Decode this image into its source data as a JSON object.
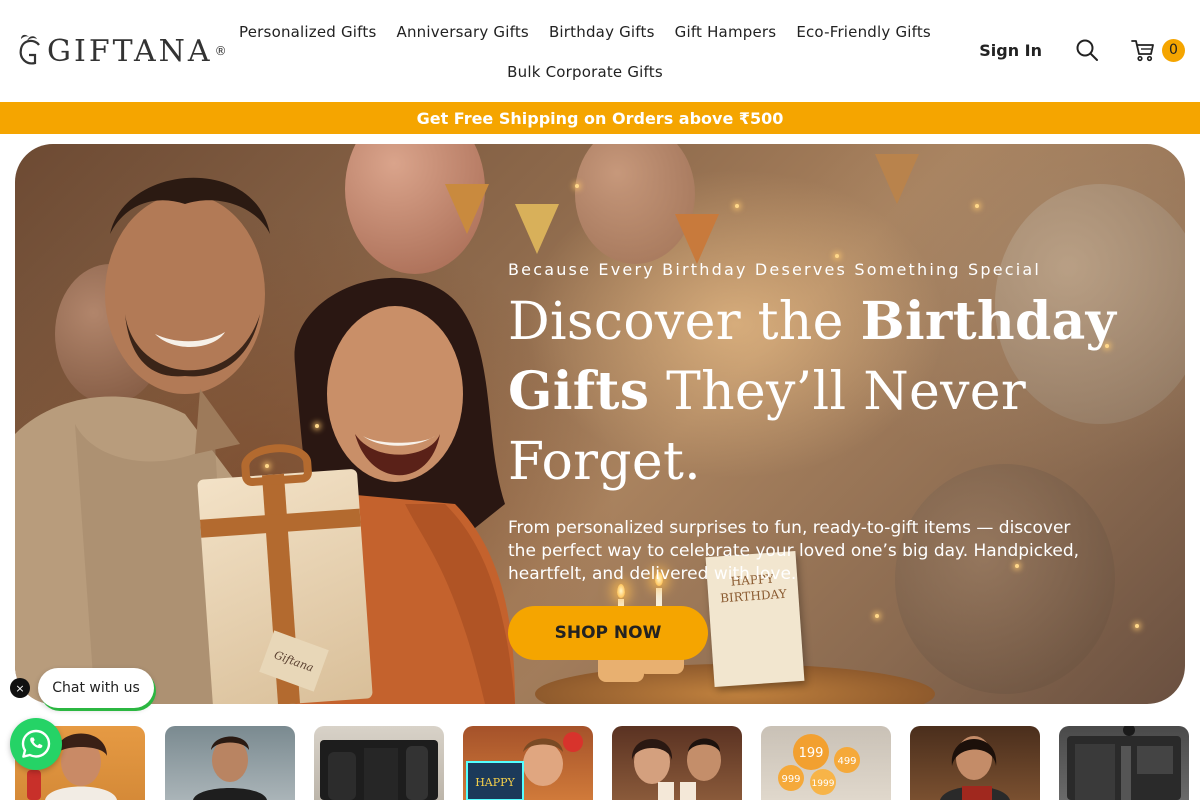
{
  "brand": {
    "logo_text": "GIFTANA",
    "logo_reg": "®"
  },
  "nav": {
    "row1": [
      "Personalized Gifts",
      "Anniversary Gifts",
      "Birthday Gifts",
      "Gift Hampers",
      "Eco-Friendly Gifts"
    ],
    "row2": [
      "Bulk Corporate Gifts"
    ]
  },
  "header": {
    "signin_label": "Sign In",
    "search_icon": "search-icon",
    "cart_icon": "cart-icon",
    "cart_count": "0"
  },
  "announcement": {
    "text": "Get Free Shipping on Orders above ₹500"
  },
  "hero": {
    "eyebrow": "Because Every Birthday Deserves Something Special",
    "headline_part1": "Discover the ",
    "headline_bold1": "Birthday",
    "headline_bold2": "Gifts",
    "headline_part2": " They’ll Never Forget.",
    "description": "From personalized surprises to fun, ready-to-gift items — discover the perfect way to celebrate your loved one’s big day. Handpicked, heartfelt, and delivered with love.",
    "cta_label": "SHOP NOW",
    "gift_tag_text": "Giftana",
    "card_text": "HAPPY BIRTHDAY"
  },
  "chat": {
    "close_label": "×",
    "label": "Chat with us",
    "whatsapp_icon": "whatsapp-icon"
  },
  "colors": {
    "accent": "#f5a500",
    "whatsapp": "#25d366",
    "text": "#222222"
  },
  "category_strip": {
    "tiles": [
      {
        "theme": "woman-with-bottle"
      },
      {
        "theme": "man-in-city"
      },
      {
        "theme": "black-gift-set"
      },
      {
        "theme": "child-with-happy-sign"
      },
      {
        "theme": "couple-with-mugs"
      },
      {
        "theme": "price-balloons"
      },
      {
        "theme": "woman-opening-gift"
      },
      {
        "theme": "tech-kit"
      }
    ],
    "price_balloons": [
      "199",
      "499",
      "999",
      "1999"
    ]
  }
}
